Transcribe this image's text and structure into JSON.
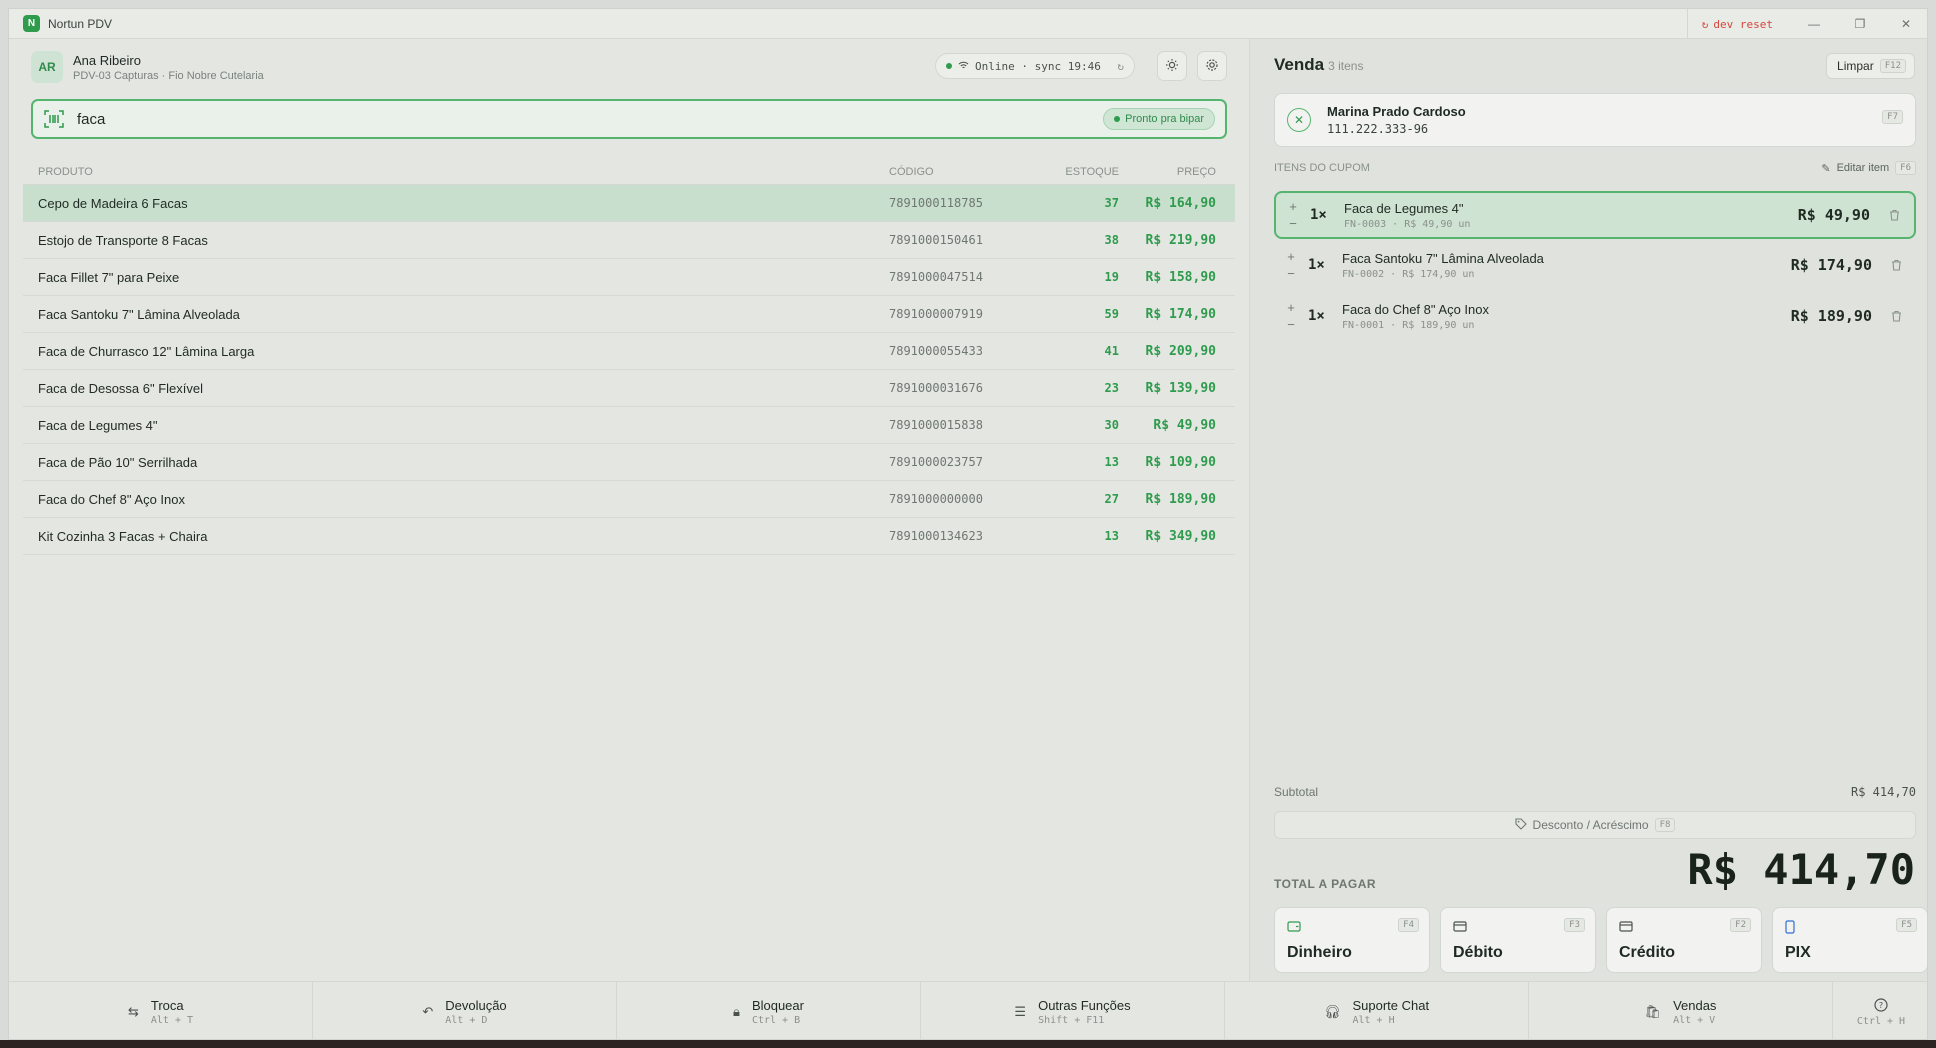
{
  "window": {
    "app_title": "Nortun PDV",
    "app_logo_letter": "N",
    "dev_reset": "dev reset"
  },
  "user": {
    "initials": "AR",
    "name": "Ana Ribeiro",
    "subtitle": "PDV-03 Capturas · Fio Nobre Cutelaria"
  },
  "status": {
    "text": "Online · sync 19:46"
  },
  "search": {
    "value": "faca",
    "ready_label": "Pronto pra bipar"
  },
  "table": {
    "headers": {
      "name": "PRODUTO",
      "code": "CÓDIGO",
      "stock": "ESTOQUE",
      "price": "PREÇO"
    },
    "rows": [
      {
        "name": "Cepo de Madeira 6 Facas",
        "code": "7891000118785",
        "stock": "37",
        "price": "R$ 164,90"
      },
      {
        "name": "Estojo de Transporte 8 Facas",
        "code": "7891000150461",
        "stock": "38",
        "price": "R$ 219,90"
      },
      {
        "name": "Faca Fillet 7\" para Peixe",
        "code": "7891000047514",
        "stock": "19",
        "price": "R$ 158,90"
      },
      {
        "name": "Faca Santoku 7\" Lâmina Alveolada",
        "code": "7891000007919",
        "stock": "59",
        "price": "R$ 174,90"
      },
      {
        "name": "Faca de Churrasco 12\" Lâmina Larga",
        "code": "7891000055433",
        "stock": "41",
        "price": "R$ 209,90"
      },
      {
        "name": "Faca de Desossa 6\" Flexível",
        "code": "7891000031676",
        "stock": "23",
        "price": "R$ 139,90"
      },
      {
        "name": "Faca de Legumes 4\"",
        "code": "7891000015838",
        "stock": "30",
        "price": "R$ 49,90"
      },
      {
        "name": "Faca de Pão 10\" Serrilhada",
        "code": "7891000023757",
        "stock": "13",
        "price": "R$ 109,90"
      },
      {
        "name": "Faca do Chef 8\" Aço Inox",
        "code": "7891000000000",
        "stock": "27",
        "price": "R$ 189,90"
      },
      {
        "name": "Kit Cozinha 3 Facas + Chaira",
        "code": "7891000134623",
        "stock": "13",
        "price": "R$ 349,90"
      }
    ]
  },
  "sale": {
    "title": "Venda",
    "count": "3 itens",
    "clear_label": "Limpar",
    "clear_key": "F12",
    "customer": {
      "name": "Marina Prado Cardoso",
      "document": "111.222.333-96",
      "key": "F7"
    },
    "items_header": "ITENS DO CUPOM",
    "edit_label": "Editar item",
    "edit_key": "F6",
    "items": [
      {
        "qty": "1×",
        "name": "Faca de Legumes 4\"",
        "sub": "FN-0003 · R$ 49,90 un",
        "price": "R$ 49,90"
      },
      {
        "qty": "1×",
        "name": "Faca Santoku 7\" Lâmina Alveolada",
        "sub": "FN-0002 · R$ 174,90 un",
        "price": "R$ 174,90"
      },
      {
        "qty": "1×",
        "name": "Faca do Chef 8\" Aço Inox",
        "sub": "FN-0001 · R$ 189,90 un",
        "price": "R$ 189,90"
      }
    ],
    "subtotal_label": "Subtotal",
    "subtotal_value": "R$ 414,70",
    "discount_label": "Desconto / Acréscimo",
    "discount_key": "F8",
    "total_label": "TOTAL A PAGAR",
    "total_value": "R$ 414,70",
    "payments": [
      {
        "label": "Dinheiro",
        "key": "F4",
        "icon": "wallet-icon"
      },
      {
        "label": "Débito",
        "key": "F3",
        "icon": "card-icon"
      },
      {
        "label": "Crédito",
        "key": "F2",
        "icon": "card-icon"
      },
      {
        "label": "PIX",
        "key": "F5",
        "icon": "phone-icon"
      }
    ]
  },
  "footer": [
    {
      "label": "Troca",
      "keys": "Alt + T",
      "icon": "swap-icon"
    },
    {
      "label": "Devolução",
      "keys": "Alt + D",
      "icon": "undo-icon"
    },
    {
      "label": "Bloquear",
      "keys": "Ctrl + B",
      "icon": "lock-icon"
    },
    {
      "label": "Outras Funções",
      "keys": "Shift + F11",
      "icon": "list-icon"
    },
    {
      "label": "Suporte Chat",
      "keys": "Alt + H",
      "icon": "headset-icon"
    },
    {
      "label": "Vendas",
      "keys": "Alt + V",
      "icon": "bag-icon"
    },
    {
      "label": "",
      "keys": "Ctrl + H",
      "icon": "help-icon"
    }
  ],
  "colors": {
    "accent": "#2e9b4d",
    "selected_row": "#c8dfcd",
    "danger": "#d4453a"
  }
}
